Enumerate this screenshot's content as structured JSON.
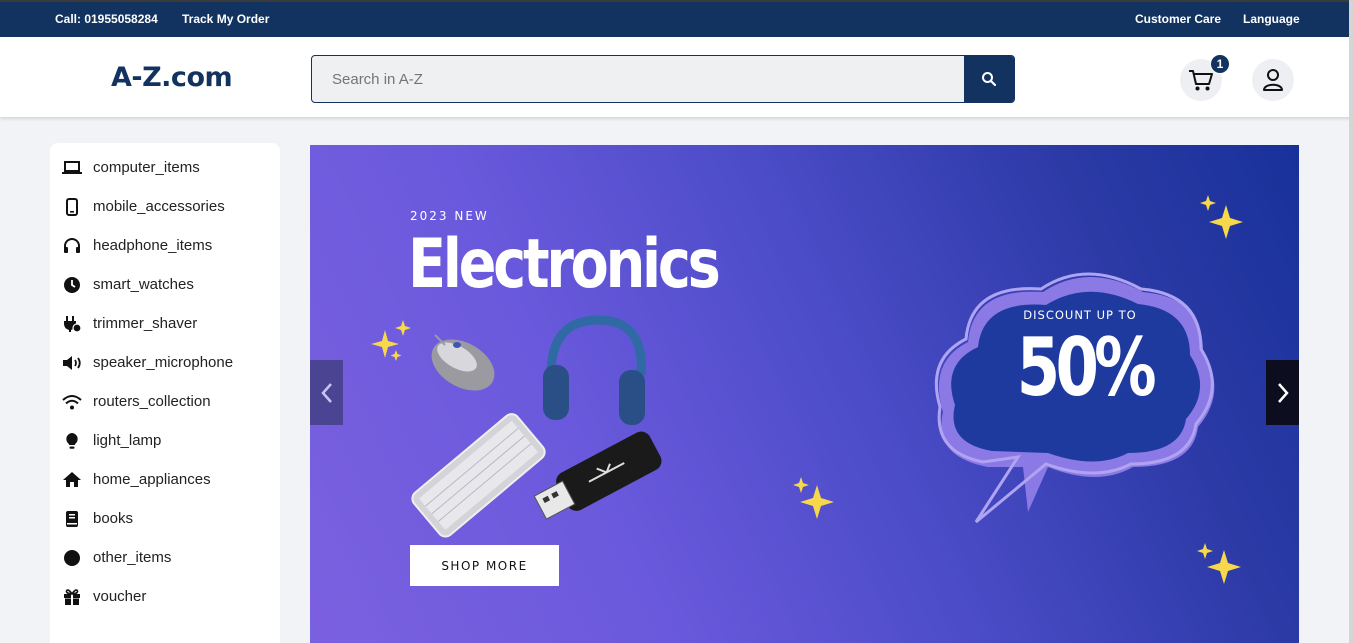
{
  "topbar": {
    "call": "Call: 01955058284",
    "track": "Track My Order",
    "care": "Customer Care",
    "language": "Language"
  },
  "header": {
    "logo": "A-Z.com",
    "search_placeholder": "Search in A-Z",
    "cart_count": "1"
  },
  "sidebar": {
    "items": [
      {
        "label": "computer_items",
        "icon": "laptop-icon"
      },
      {
        "label": "mobile_accessories",
        "icon": "mobile-icon"
      },
      {
        "label": "headphone_items",
        "icon": "headphones-icon"
      },
      {
        "label": "smart_watches",
        "icon": "clock-icon"
      },
      {
        "label": "trimmer_shaver",
        "icon": "plug-icon"
      },
      {
        "label": "speaker_microphone",
        "icon": "speaker-icon"
      },
      {
        "label": "routers_collection",
        "icon": "wifi-icon"
      },
      {
        "label": "light_lamp",
        "icon": "lightbulb-icon"
      },
      {
        "label": "home_appliances",
        "icon": "home-icon"
      },
      {
        "label": "books",
        "icon": "book-icon"
      },
      {
        "label": "other_items",
        "icon": "circle-icon"
      },
      {
        "label": "voucher",
        "icon": "gift-icon"
      }
    ]
  },
  "banner": {
    "subtitle": "2023 NEW",
    "title": "Electronics",
    "button": "SHOP MORE",
    "discount_text": "DISCOUNT UP TO",
    "discount_value": "50%"
  },
  "colors": {
    "brand": "#12335f",
    "banner_start": "#7b61e0",
    "banner_end": "#18319a"
  }
}
